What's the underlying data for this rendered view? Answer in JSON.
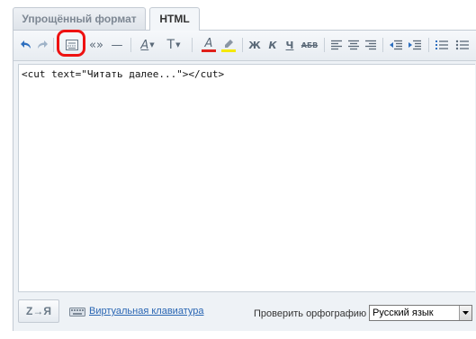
{
  "tabs": {
    "simple_label": "Упрощённый формат",
    "html_label": "HTML",
    "active": "HTML"
  },
  "toolbar": {
    "buttons": [
      {
        "name": "undo-icon"
      },
      {
        "name": "redo-icon"
      },
      {
        "name": "cut-tag-icon"
      },
      {
        "name": "quotes-icon",
        "glyph": "«»"
      },
      {
        "name": "dash-icon",
        "glyph": "—"
      },
      {
        "name": "font-style-icon",
        "glyph": "A"
      },
      {
        "name": "font-size-icon",
        "glyph": "T"
      },
      {
        "name": "text-color-icon",
        "glyph": "A"
      },
      {
        "name": "highlight-icon"
      },
      {
        "name": "bold-icon",
        "glyph": "Ж"
      },
      {
        "name": "italic-icon",
        "glyph": "К"
      },
      {
        "name": "underline-icon",
        "glyph": "Ч"
      },
      {
        "name": "strikethrough-icon",
        "glyph": "АБВ"
      },
      {
        "name": "align-left-icon"
      },
      {
        "name": "align-center-icon"
      },
      {
        "name": "align-right-icon"
      },
      {
        "name": "outdent-icon"
      },
      {
        "name": "indent-icon"
      },
      {
        "name": "ordered-list-icon"
      },
      {
        "name": "unordered-list-icon"
      }
    ],
    "colors": {
      "text_color_bar": "#e0201a",
      "highlight_bar": "#f5e800",
      "icon": "#5a6978",
      "undo_blue": "#2d6fbf",
      "highlight_ring": "#ee1111"
    }
  },
  "editor": {
    "content": "<cut text=\"Читать далее...\"></cut>"
  },
  "statusbar": {
    "az_label": "Z→Я",
    "keyboard_link": "Виртуальная клавиатура",
    "spell_label": "Проверить орфографию",
    "spell_value": "Русский язык"
  }
}
